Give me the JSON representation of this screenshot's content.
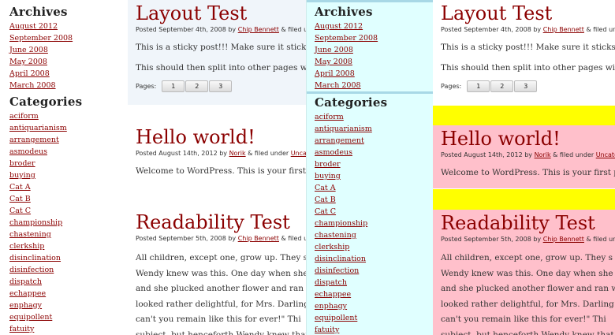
{
  "sidebar": {
    "archives_title": "Archives",
    "archives": [
      "August 2012",
      "September 2008",
      "June 2008",
      "May 2008",
      "April 2008",
      "March 2008"
    ],
    "categories_title": "Categories",
    "categories": [
      "aciform",
      "antiquarianism",
      "arrangement",
      "asmodeus",
      "broder",
      "buying",
      "Cat A",
      "Cat B",
      "Cat C",
      "championship",
      "chastening",
      "clerkship",
      "disinclination",
      "disinfection",
      "dispatch",
      "echappee",
      "enphagy",
      "equipollent",
      "fatuity"
    ]
  },
  "posts": {
    "layout": {
      "title": "Layout Test",
      "meta_prefix": "Posted September 4th, 2008 by ",
      "author": "Chip Bennett",
      "meta_suffix": " & filed under",
      "p1": "This is a sticky post!!! Make sure it sticks!",
      "p2": "This should then split into other pages with",
      "pages_label": "Pages:",
      "pages": [
        "1",
        "2",
        "3"
      ]
    },
    "hello": {
      "title": "Hello world!",
      "meta_prefix": "Posted August 14th, 2012 by ",
      "author": "Norik",
      "meta_suffix": " & filed under ",
      "category": "Uncate",
      "p1": "Welcome to WordPress. This is your first p"
    },
    "readability": {
      "title": "Readability Test",
      "meta_prefix": "Posted September 5th, 2008 by ",
      "author": "Chip Bennett",
      "meta_suffix": " & filed under",
      "lines": [
        "All children, except one, grow up. They s",
        "Wendy knew was this. One day when she",
        "and she plucked another flower and ran w",
        "looked rather delightful, for Mrs. Darling p",
        "can't you remain like this for ever!\" Thi",
        "subject, but henceforth Wendy knew that"
      ]
    }
  },
  "colors": {
    "link": "#8b0000",
    "sidebar_right_bg": "#e0ffff",
    "sticky_bg": "#f0f5fa",
    "highlight_yellow": "#ffff00",
    "highlight_pink": "#ffc0cb"
  }
}
